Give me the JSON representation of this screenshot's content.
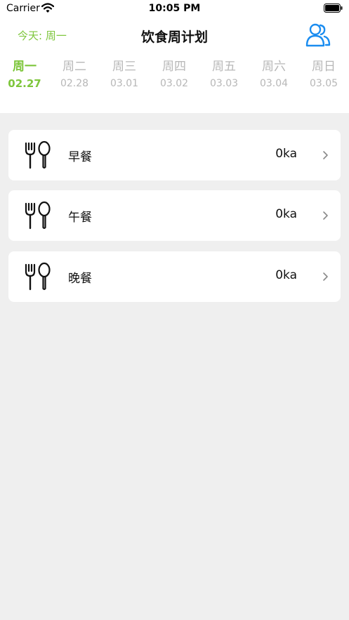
{
  "status_bar": {
    "carrier": "Carrier",
    "time": "10:05 PM"
  },
  "header": {
    "today_label": "今天: 周一",
    "title": "饮食周计划"
  },
  "days": [
    {
      "name": "周一",
      "date": "02.27",
      "active": true
    },
    {
      "name": "周二",
      "date": "02.28",
      "active": false
    },
    {
      "name": "周三",
      "date": "03.01",
      "active": false
    },
    {
      "name": "周四",
      "date": "03.02",
      "active": false
    },
    {
      "name": "周五",
      "date": "03.03",
      "active": false
    },
    {
      "name": "周六",
      "date": "03.04",
      "active": false
    },
    {
      "name": "周日",
      "date": "03.05",
      "active": false
    }
  ],
  "meals": [
    {
      "name": "早餐",
      "calories": "0ka"
    },
    {
      "name": "午餐",
      "calories": "0ka"
    },
    {
      "name": "晚餐",
      "calories": "0ka"
    }
  ],
  "colors": {
    "accent": "#7ec63c",
    "icon_blue": "#1a8cf0",
    "background": "#efefef"
  },
  "icons": [
    "wifi-icon",
    "battery-icon",
    "users-icon",
    "fork-spoon-icon",
    "chevron-right-icon"
  ]
}
